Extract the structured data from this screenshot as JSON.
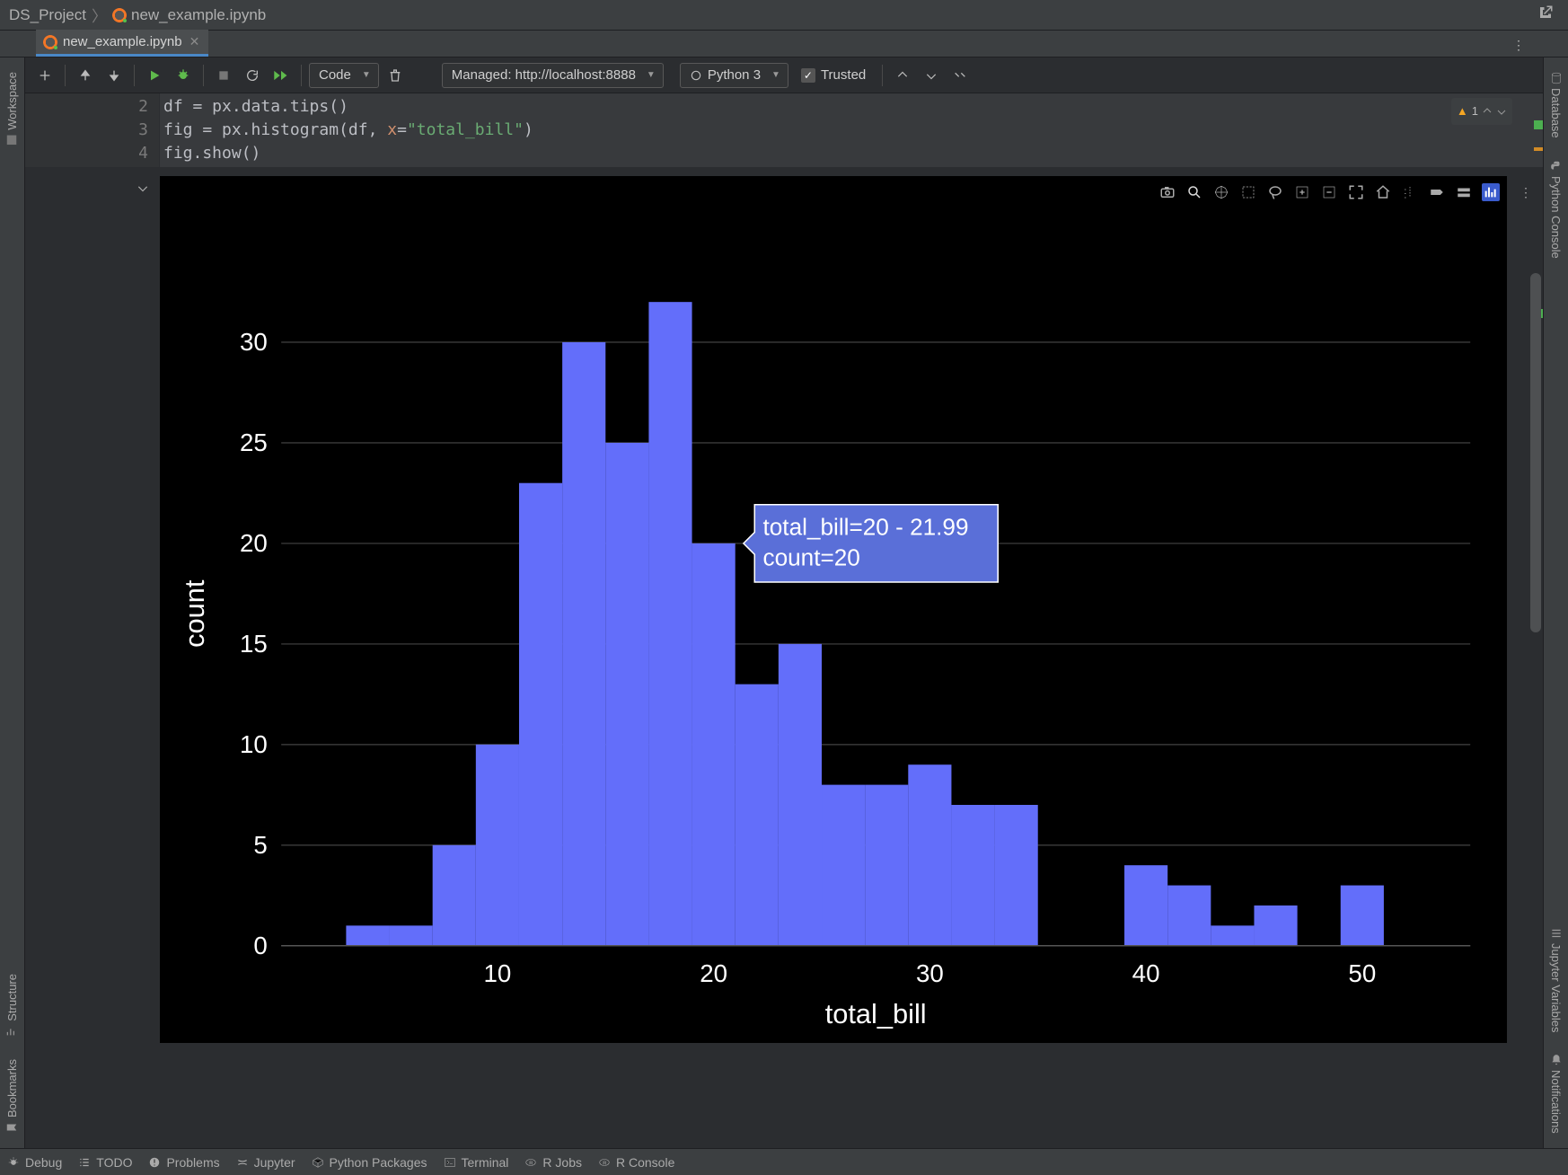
{
  "breadcrumbs": {
    "project": "DS_Project",
    "file": "new_example.ipynb"
  },
  "tab": {
    "label": "new_example.ipynb"
  },
  "toolbar": {
    "cell_type": "Code",
    "server": "Managed: http://localhost:8888",
    "kernel": "Python 3",
    "trusted": "Trusted"
  },
  "left_rail": {
    "workspace": "Workspace",
    "structure": "Structure",
    "bookmarks": "Bookmarks"
  },
  "right_rail": {
    "database": "Database",
    "python_console": "Python Console",
    "jupyter_vars": "Jupyter Variables",
    "notifications": "Notifications"
  },
  "code": {
    "lines": [
      "2",
      "3",
      "4"
    ],
    "l2_a": "df = px.data.tips()",
    "l3_a": "fig = px.histogram(df, ",
    "l3_param": "x",
    "l3_b": "=",
    "l3_str": "\"total_bill\"",
    "l3_c": ")",
    "l4_a": "fig.show()"
  },
  "warning": {
    "count": "1"
  },
  "status": {
    "debug": "Debug",
    "todo": "TODO",
    "problems": "Problems",
    "jupyter": "Jupyter",
    "pypkg": "Python Packages",
    "terminal": "Terminal",
    "rjobs": "R Jobs",
    "rconsole": "R Console"
  },
  "tooltip": {
    "line1": "total_bill=20 - 21.99",
    "line2": "count=20"
  },
  "chart_data": {
    "type": "bar",
    "title": "",
    "xlabel": "total_bill",
    "ylabel": "count",
    "categories": [
      4,
      6,
      8,
      10,
      12,
      14,
      16,
      18,
      20,
      22,
      24,
      26,
      28,
      30,
      32,
      34,
      36,
      38,
      40,
      42,
      44,
      46,
      48,
      50
    ],
    "values": [
      1,
      1,
      5,
      10,
      23,
      30,
      25,
      32,
      20,
      13,
      15,
      8,
      8,
      9,
      7,
      7,
      0,
      0,
      4,
      3,
      1,
      2,
      0,
      3
    ],
    "xlim": [
      0,
      55
    ],
    "ylim": [
      0,
      33
    ],
    "xticks": [
      10,
      20,
      30,
      40,
      50
    ],
    "yticks": [
      0,
      5,
      10,
      15,
      20,
      25,
      30
    ]
  }
}
